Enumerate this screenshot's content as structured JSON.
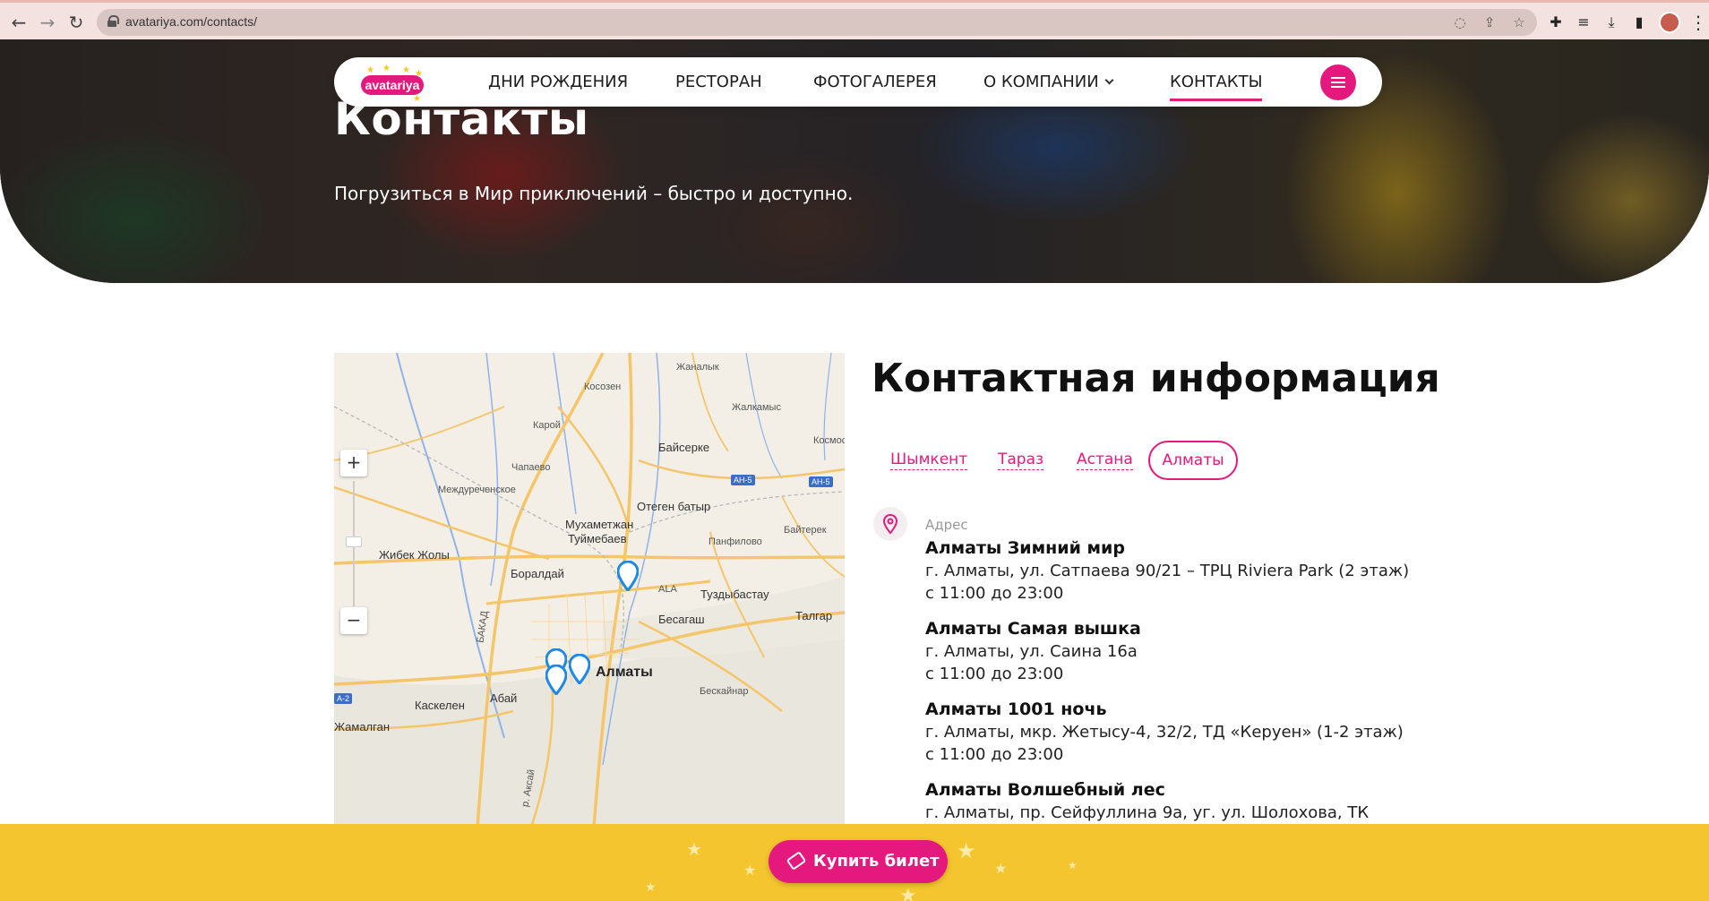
{
  "browser": {
    "url": "avatariya.com/contacts/"
  },
  "site": {
    "logo_text": "avatariya",
    "nav": [
      {
        "label": "ДНИ РОЖДЕНИЯ"
      },
      {
        "label": "РЕСТОРАН"
      },
      {
        "label": "ФОТОГАЛЕРЕЯ"
      },
      {
        "label": "О КОМПАНИИ"
      },
      {
        "label": "КОНТАКТЫ"
      }
    ]
  },
  "hero": {
    "title": "Контакты",
    "subtitle": "Погрузиться в Мир приключений – быстро и доступно."
  },
  "map": {
    "zoom_in": "+",
    "zoom_out": "−",
    "labels": {
      "zhanalyk": "Жаналык",
      "kosozen": "Косозен",
      "zhalkamys": "Жалкамыс",
      "karoy": "Карой",
      "bayserke": "Байсерке",
      "kosmos": "Космос",
      "chapaevo": "Чапаево",
      "mezhdurechenskoe": "Междуреченское",
      "otegen": "Отеген батыр",
      "mukhametzhan": "Мухаметжан",
      "tuymebaev": "Туймебаев",
      "panfilovo": "Панфилово",
      "bayterek": "Байтерек",
      "zhibek": "Жибек Жолы",
      "boralday": "Боралдай",
      "ala": "ALA",
      "tuzdybastau": "Туздыбастау",
      "besagash": "Бесагаш",
      "talgar": "Талгар",
      "almaty": "Алматы",
      "beskainar": "Бескайнар",
      "abay": "Абай",
      "kaskelen": "Каскелен",
      "zhamalgan": "Жамалган",
      "bakad": "БАКАД",
      "aksai": "р. Аксай"
    },
    "road_badges": {
      "ah5a": "АН-5",
      "ah5b": "АН-5",
      "a2": "А-2"
    }
  },
  "contacts": {
    "title": "Контактная информация",
    "tabs": [
      "Шымкент",
      "Тараз",
      "Астана"
    ],
    "active_tab": "Алматы",
    "address_label": "Адрес",
    "locations": [
      {
        "name": "Алматы Зимний мир",
        "address": "г. Алматы, ул. Сатпаева 90/21 – ТРЦ Riviera Park (2 этаж)",
        "hours": "с 11:00 до 23:00"
      },
      {
        "name": "Алматы Самая вышка",
        "address": "г. Алматы, ул. Саина 16а",
        "hours": "с 11:00 до 23:00"
      },
      {
        "name": "Алматы 1001 ночь",
        "address": "г. Алматы, мкр. Жетысу-4, 32/2, ТД «Керуен» (1-2 этаж)",
        "hours": "с 11:00 до 23:00"
      },
      {
        "name": "Алматы Волшебный лес",
        "address": "г. Алматы, пр. Сейфуллина 9а, уг. ул. Шолохова, ТК"
      }
    ]
  },
  "cta": {
    "buy_ticket": "Купить билет"
  },
  "colors": {
    "brand_pink": "#e5197d",
    "brand_yellow": "#f4c52e"
  }
}
